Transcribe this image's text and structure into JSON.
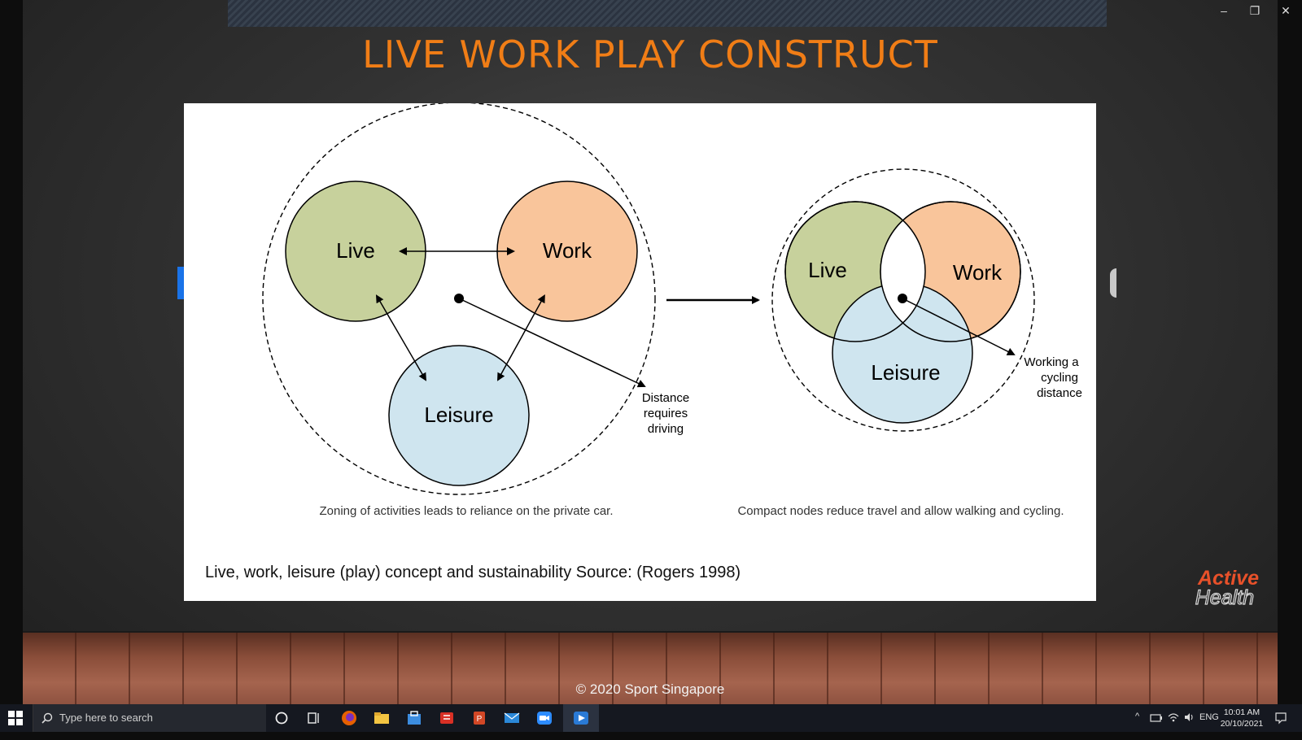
{
  "slide": {
    "title": "LIVE WORK PLAY CONSTRUCT",
    "caption": "Live, work, leisure (play) concept and sustainability Source: (Rogers 1998)",
    "copyright": "© 2020 Sport Singapore",
    "logo_line1": "Active",
    "logo_line2": "Health"
  },
  "diagram": {
    "left": {
      "live": "Live",
      "work": "Work",
      "leisure": "Leisure",
      "note_line1": "Distance",
      "note_line2": "requires",
      "note_line3": "driving",
      "caption": "Zoning of activities leads to reliance on the private car."
    },
    "right": {
      "live": "Live",
      "work": "Work",
      "leisure": "Leisure",
      "note_line1": "Working a",
      "note_line2": "cycling",
      "note_line3": "distance",
      "caption": "Compact nodes reduce travel and allow walking and cycling."
    },
    "colors": {
      "live": "#c7d19c",
      "work": "#f9c59b",
      "leisure": "#cfe5ef"
    }
  },
  "taskbar": {
    "search_placeholder": "Type here to search",
    "lang": "ENG",
    "time": "10:01 AM",
    "date": "20/10/2021"
  },
  "window": {
    "minimize": "–",
    "restore": "❐",
    "close": "✕"
  }
}
